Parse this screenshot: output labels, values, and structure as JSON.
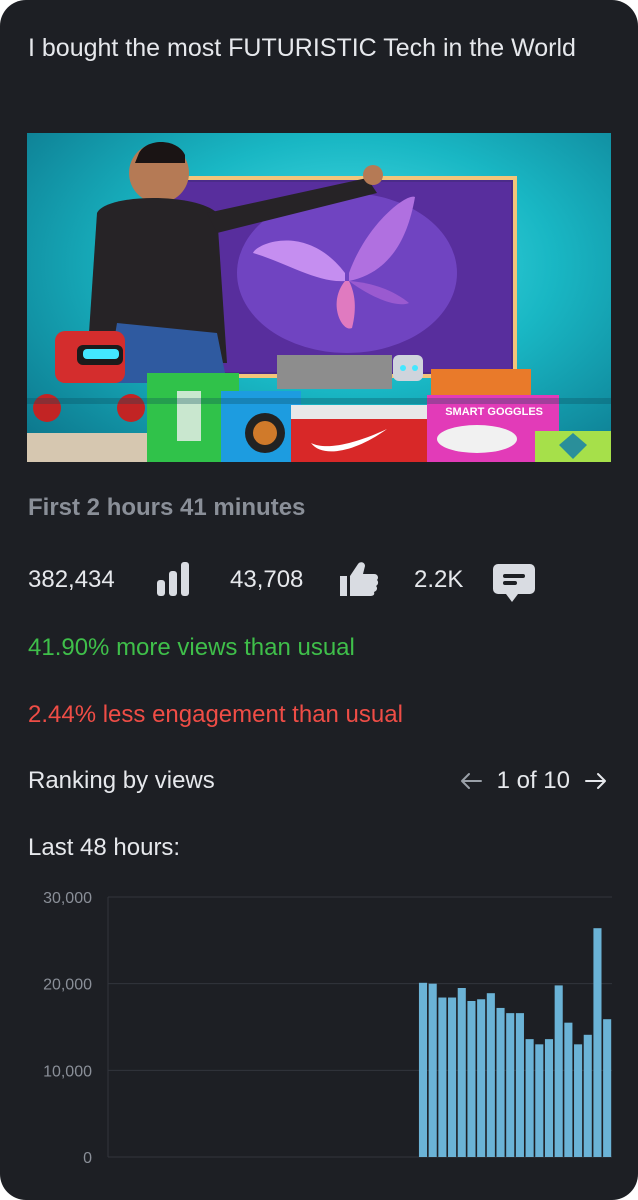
{
  "video": {
    "title": "I bought the most FUTURISTIC Tech in the World",
    "thumbnail_text": "SMART GOGGLES"
  },
  "period_label": "First 2 hours 41 minutes",
  "stats": {
    "views": "382,434",
    "likes": "43,708",
    "comments": "2.2K"
  },
  "insights": {
    "views_change": "41.90% more views than usual",
    "engagement_change": "2.44% less engagement than usual"
  },
  "ranking": {
    "label": "Ranking by views",
    "position": "1 of 10"
  },
  "chart_title": "Last 48 hours:",
  "colors": {
    "background": "#1d1f24",
    "positive": "#3fbf4a",
    "negative": "#ef4d46",
    "bar": "#6bb3d6"
  },
  "chart_data": {
    "type": "bar",
    "title": "Last 48 hours:",
    "ylim": [
      0,
      30000
    ],
    "yticks": [
      "30,000",
      "20,000",
      "10,000",
      "0"
    ],
    "ytick_values": [
      30000,
      20000,
      10000,
      0
    ],
    "bar_count": 48,
    "values": [
      0,
      0,
      0,
      0,
      0,
      0,
      0,
      0,
      0,
      0,
      0,
      0,
      0,
      0,
      0,
      0,
      0,
      0,
      0,
      0,
      0,
      0,
      0,
      0,
      0,
      0,
      0,
      0,
      0,
      0,
      0,
      0,
      20100,
      20000,
      18400,
      18400,
      19500,
      18000,
      18200,
      18900,
      17200,
      16600,
      16600,
      13600,
      13000,
      13600,
      19800,
      15500,
      13000,
      14100,
      26400,
      15900
    ]
  }
}
